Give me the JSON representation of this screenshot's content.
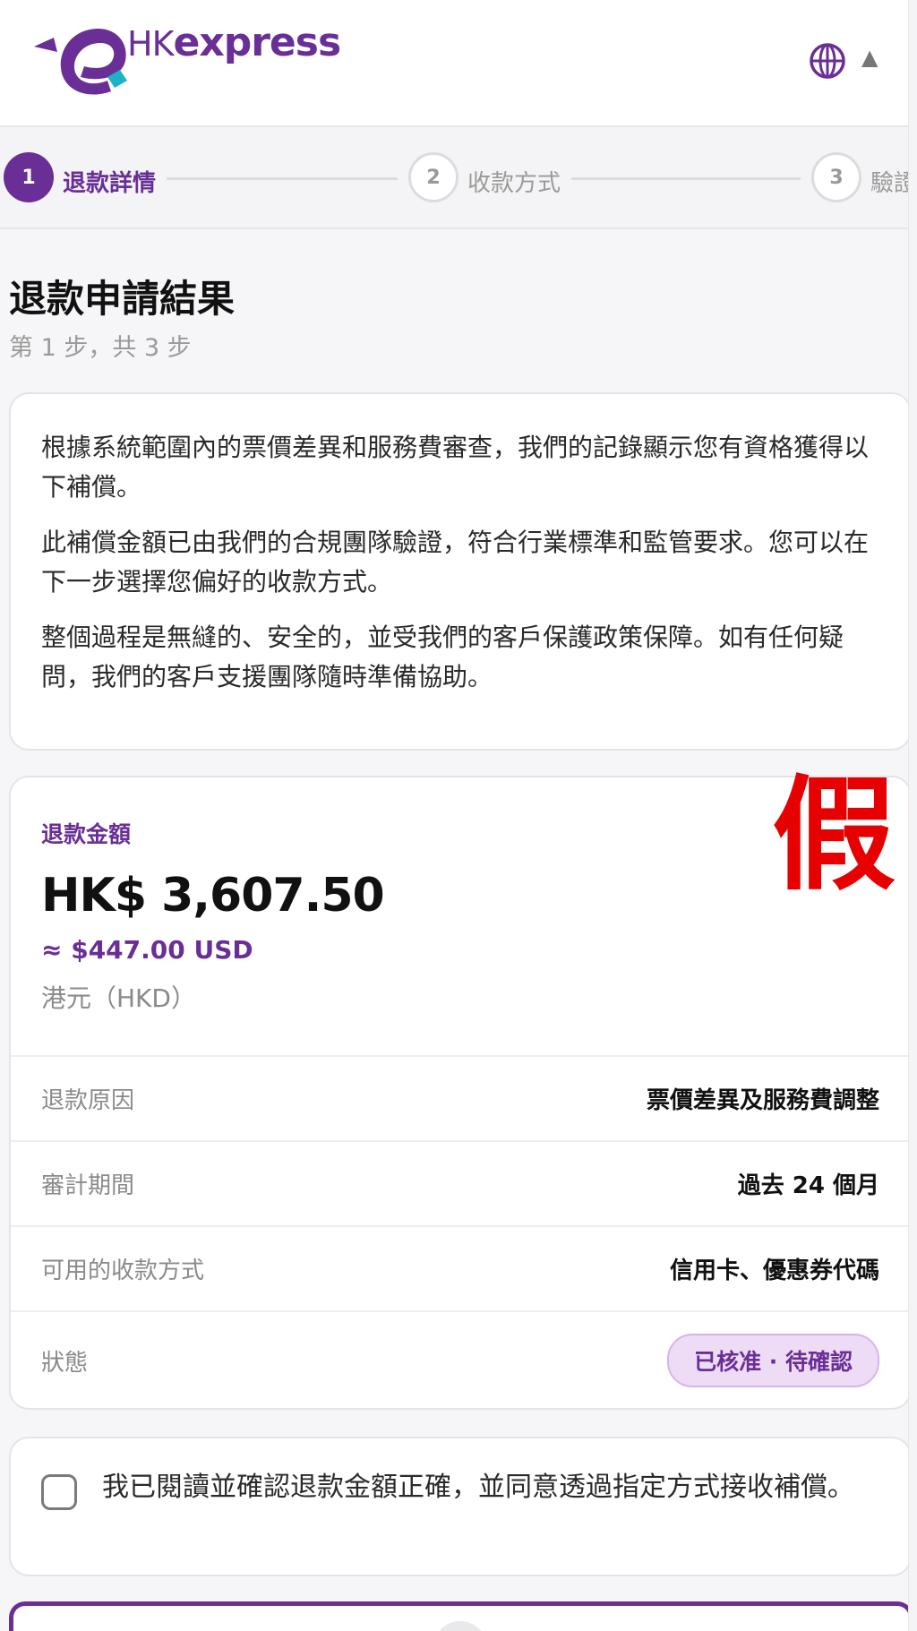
{
  "header": {
    "brand_prefix": "HK",
    "brand_name": "express",
    "lang_icon": "globe-icon",
    "caret_icon": "caret-up-icon",
    "caret_glyph": "▲"
  },
  "stepper": {
    "steps": [
      {
        "number": "1",
        "label": "退款詳情",
        "state": "active"
      },
      {
        "number": "2",
        "label": "收款方式",
        "state": "inactive"
      },
      {
        "number": "3",
        "label": "驗證",
        "state": "inactive"
      }
    ]
  },
  "page": {
    "title": "退款申請結果",
    "subtitle": "第 1 步，共 3 步"
  },
  "info": {
    "paragraphs": [
      "根據系統範圍內的票價差異和服務費審查，我們的記錄顯示您有資格獲得以下補償。",
      "此補償金額已由我們的合規團隊驗證，符合行業標準和監管要求。您可以在下一步選擇您偏好的收款方式。",
      "整個過程是無縫的、安全的，並受我們的客戶保護政策保障。如有任何疑問，我們的客戶支援團隊隨時準備協助。"
    ]
  },
  "refund": {
    "label": "退款金額",
    "amount": "HK$ 3,607.50",
    "usd_equiv": "≈ $447.00 USD",
    "currency": "港元（HKD）",
    "fake_mark": "假",
    "rows": [
      {
        "key": "退款原因",
        "value": "票價差異及服務費調整"
      },
      {
        "key": "審計期間",
        "value": "過去 24 個月"
      },
      {
        "key": "可用的收款方式",
        "value": "信用卡、優惠券代碼"
      }
    ],
    "status_key": "狀態",
    "status_value": "已核准 · 待確認"
  },
  "confirm": {
    "text": "我已閱讀並確認退款金額正確，並同意透過指定方式接收補償。",
    "checked": false
  },
  "colors": {
    "brand_purple": "#6a2f96",
    "logo_teal": "#1cb3c8",
    "fake_red": "#e60000"
  }
}
